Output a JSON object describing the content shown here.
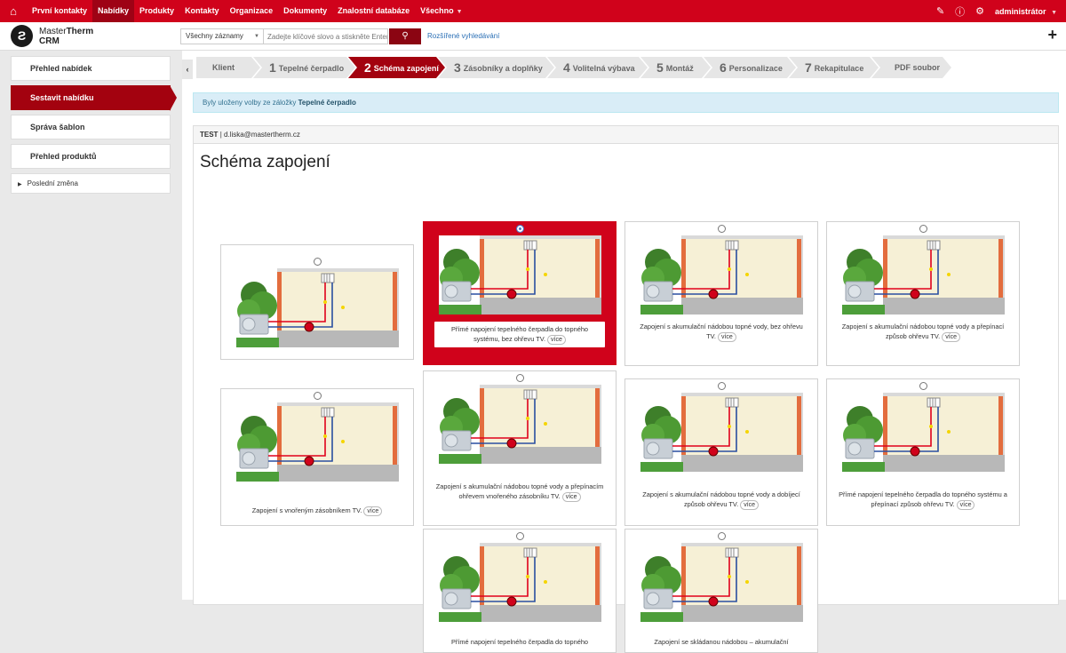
{
  "topnav": {
    "items": [
      {
        "label": "První kontakty"
      },
      {
        "label": "Nabídky"
      },
      {
        "label": "Produkty"
      },
      {
        "label": "Kontakty"
      },
      {
        "label": "Organizace"
      },
      {
        "label": "Dokumenty"
      },
      {
        "label": "Znalostní databáze"
      },
      {
        "label": "Všechno"
      }
    ],
    "active_item": "Nabídky",
    "user": "administrátor"
  },
  "header": {
    "logo_brand_a": "Master",
    "logo_brand_b": "Therm",
    "logo_sub": "CRM",
    "search_scope": "Všechny záznamy",
    "search_placeholder": "Zadejte klíčové slovo a stiskněte Enter",
    "advanced_search": "Rozšířené vyhledávání"
  },
  "sidebar": {
    "items": [
      {
        "label": "Přehled nabídek"
      },
      {
        "label": "Sestavit nabídku"
      },
      {
        "label": "Správa šablon"
      },
      {
        "label": "Přehled produktů"
      }
    ],
    "active_item": "Sestavit nabídku",
    "recent": "Poslední změna"
  },
  "steps": [
    {
      "num": "",
      "label": "Klient"
    },
    {
      "num": "1",
      "label": "Tepelné čerpadlo"
    },
    {
      "num": "2",
      "label": "Schéma zapojení"
    },
    {
      "num": "3",
      "label": "Zásobníky a doplňky"
    },
    {
      "num": "4",
      "label": "Volitelná výbava"
    },
    {
      "num": "5",
      "label": "Montáž"
    },
    {
      "num": "6",
      "label": "Personalizace"
    },
    {
      "num": "7",
      "label": "Rekapitulace"
    },
    {
      "num": "",
      "label": "PDF soubor"
    }
  ],
  "active_step": "Schéma zapojení",
  "info": {
    "text": "Byly uloženy volby ze záložky",
    "link": "Tepelné čerpadlo"
  },
  "panel": {
    "client": "TEST",
    "separator": "|",
    "email": "d.liska@mastertherm.cz",
    "title": "Schéma zapojení"
  },
  "schemes": [
    {
      "caption": "",
      "selected": false
    },
    {
      "caption": "Přímé napojení tepelného čerpadla do topného systému, bez ohřevu TV.",
      "selected": true
    },
    {
      "caption": "Zapojení s akumulační nádobou topné vody, bez ohřevu TV.",
      "selected": false
    },
    {
      "caption": "Zapojení s akumulační nádobou topné vody a přepínací způsob ohřevu TV.",
      "selected": false
    },
    {
      "caption": "Zapojení s vnořeným zásobníkem TV.",
      "selected": false
    },
    {
      "caption": "Zapojení s akumulační nádobou topné vody a přepínacím ohřevem vnořeného zásobníku TV.",
      "selected": false
    },
    {
      "caption": "Zapojení s akumulační nádobou topné vody a dobíjecí způsob ohřevu TV.",
      "selected": false
    },
    {
      "caption": "Přímé napojení tepelného čerpadla do topného systému a přepínací způsob ohřevu TV.",
      "selected": false
    },
    {
      "caption": "Přímé napojení tepelného čerpadla do topného",
      "selected": false
    },
    {
      "caption": "Zapojení se skládanou nádobou – akumulační",
      "selected": false
    }
  ],
  "more_label": "více",
  "colors": {
    "brand": "#d0021b",
    "brand_dark": "#a3020f",
    "info_bg": "#d9edf7"
  }
}
